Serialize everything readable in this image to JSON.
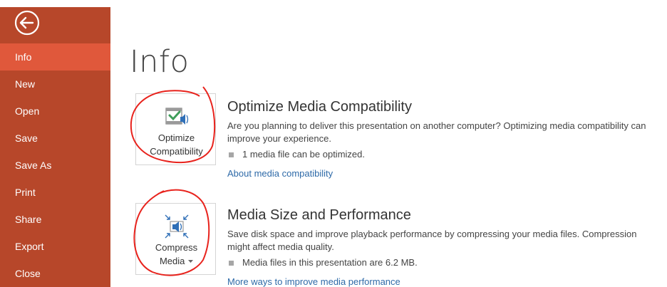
{
  "sidebar": {
    "back_label": "Back",
    "items": [
      {
        "label": "Info",
        "active": true
      },
      {
        "label": "New"
      },
      {
        "label": "Open"
      },
      {
        "label": "Save"
      },
      {
        "label": "Save As"
      },
      {
        "label": "Print"
      },
      {
        "label": "Share"
      },
      {
        "label": "Export"
      },
      {
        "label": "Close"
      }
    ]
  },
  "main": {
    "title": "Info",
    "optimize": {
      "button_label_line1": "Optimize",
      "button_label_line2": "Compatibility",
      "heading": "Optimize Media Compatibility",
      "description": "Are you planning to deliver this presentation on another computer? Optimizing media compatibility can improve your experience.",
      "bullet": "1 media file can be optimized.",
      "link": "About media compatibility"
    },
    "compress": {
      "button_label_line1": "Compress",
      "button_label_line2": "Media",
      "heading": "Media Size and Performance",
      "description": "Save disk space and improve playback performance by compressing your media files. Compression might affect media quality.",
      "bullet": "Media files in this presentation are 6.2 MB.",
      "link": "More ways to improve media performance"
    }
  },
  "colors": {
    "sidebar": "#b7472a",
    "sidebar_active": "#e0583b",
    "link": "#2e6aa8",
    "annotation": "#e8231d"
  },
  "icons": {
    "back": "arrow-left-circle-icon",
    "optimize": "film-checkmark-speaker-icon",
    "compress": "speaker-compress-arrows-icon",
    "dropdown": "dropdown-caret-icon"
  }
}
